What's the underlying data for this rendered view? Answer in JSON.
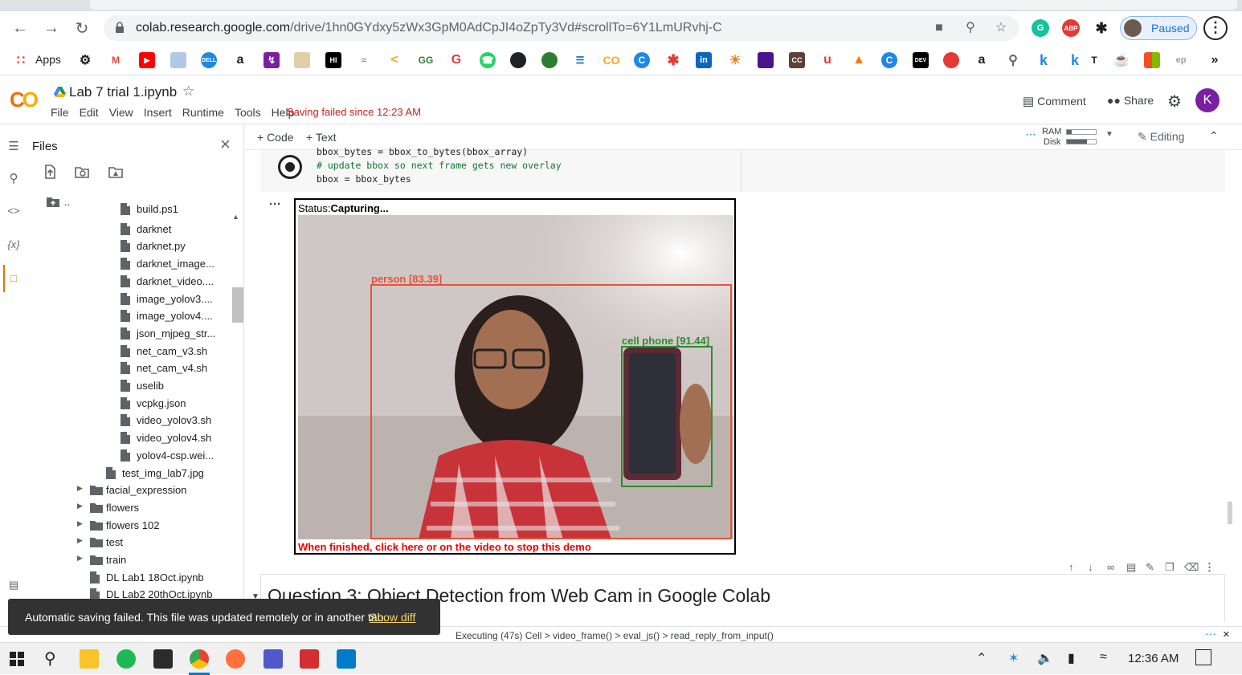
{
  "browser": {
    "url_host": "colab.research.google.com",
    "url_path": "/drive/1hn0GYdxy5zWx3GpM0AdCpJI4oZpTy3Vd#scrollTo=6Y1LmURvhj-C",
    "profile_label": "Paused",
    "bookmarks_apps_label": "Apps"
  },
  "colab": {
    "notebook_title": "Lab 7 trial 1.ipynb",
    "menu": [
      "File",
      "Edit",
      "View",
      "Insert",
      "Runtime",
      "Tools",
      "Help"
    ],
    "save_status": "Saving failed since 12:23 AM",
    "comment_label": "Comment",
    "share_label": "Share",
    "avatar_letter": "K"
  },
  "files_panel": {
    "title": "Files",
    "parent_label": "..",
    "items": [
      {
        "name": "build.ps1",
        "type": "file",
        "indent": 2
      },
      {
        "name": "darknet",
        "type": "file",
        "indent": 2
      },
      {
        "name": "darknet.py",
        "type": "file",
        "indent": 2
      },
      {
        "name": "darknet_image...",
        "type": "file",
        "indent": 2
      },
      {
        "name": "darknet_video....",
        "type": "file",
        "indent": 2
      },
      {
        "name": "image_yolov3....",
        "type": "file",
        "indent": 2
      },
      {
        "name": "image_yolov4....",
        "type": "file",
        "indent": 2
      },
      {
        "name": "json_mjpeg_str...",
        "type": "file",
        "indent": 2
      },
      {
        "name": "net_cam_v3.sh",
        "type": "file",
        "indent": 2
      },
      {
        "name": "net_cam_v4.sh",
        "type": "file",
        "indent": 2
      },
      {
        "name": "uselib",
        "type": "file",
        "indent": 2
      },
      {
        "name": "vcpkg.json",
        "type": "file",
        "indent": 2
      },
      {
        "name": "video_yolov3.sh",
        "type": "file",
        "indent": 2
      },
      {
        "name": "video_yolov4.sh",
        "type": "file",
        "indent": 2
      },
      {
        "name": "yolov4-csp.wei...",
        "type": "file",
        "indent": 2
      },
      {
        "name": "test_img_lab7.jpg",
        "type": "file",
        "indent": 1
      },
      {
        "name": "facial_expression",
        "type": "folder",
        "indent": 0
      },
      {
        "name": "flowers",
        "type": "folder",
        "indent": 0
      },
      {
        "name": "flowers 102",
        "type": "folder",
        "indent": 0
      },
      {
        "name": "test",
        "type": "folder",
        "indent": 0
      },
      {
        "name": "train",
        "type": "folder",
        "indent": 0
      },
      {
        "name": "DL Lab1 18Oct.ipynb",
        "type": "file",
        "indent": 0
      },
      {
        "name": "DL Lab2 20thOct.ipynb",
        "type": "file",
        "indent": 0
      }
    ]
  },
  "toolbar": {
    "add_code": "+ Code",
    "add_text": "+ Text",
    "ram_label": "RAM",
    "disk_label": "Disk",
    "editing_label": "Editing"
  },
  "code_cell": {
    "lines": [
      "bbox_bytes = bbox_to_bytes(bbox_array)",
      "# update bbox so next frame gets new overlay",
      "bbox = bbox_bytes"
    ]
  },
  "output": {
    "status_prefix": "Status:",
    "status_value": "Capturing...",
    "detections": [
      {
        "label": "person [83.39]",
        "color": "#e8513a"
      },
      {
        "label": "cell phone [91.44]",
        "color": "#2e8b2e"
      }
    ],
    "stop_text": "When finished, click here or on the video to stop this demo"
  },
  "text_cell": {
    "heading": "Question 3: Object Detection from Web Cam in Google Colab"
  },
  "status_bar": {
    "text": "Executing (47s)  Cell > video_frame() > eval_js() > read_reply_from_input()"
  },
  "toast": {
    "message": "Automatic saving failed. This file was updated remotely or in another tab.",
    "action": "Show diff"
  },
  "taskbar": {
    "clock": "12:36 AM"
  },
  "colors": {
    "save_error": "#c5221f",
    "colab_orange": "#e8710a",
    "colab_yellow": "#f9ab00",
    "toast_bg": "#323232",
    "toast_link": "#fdd663"
  }
}
